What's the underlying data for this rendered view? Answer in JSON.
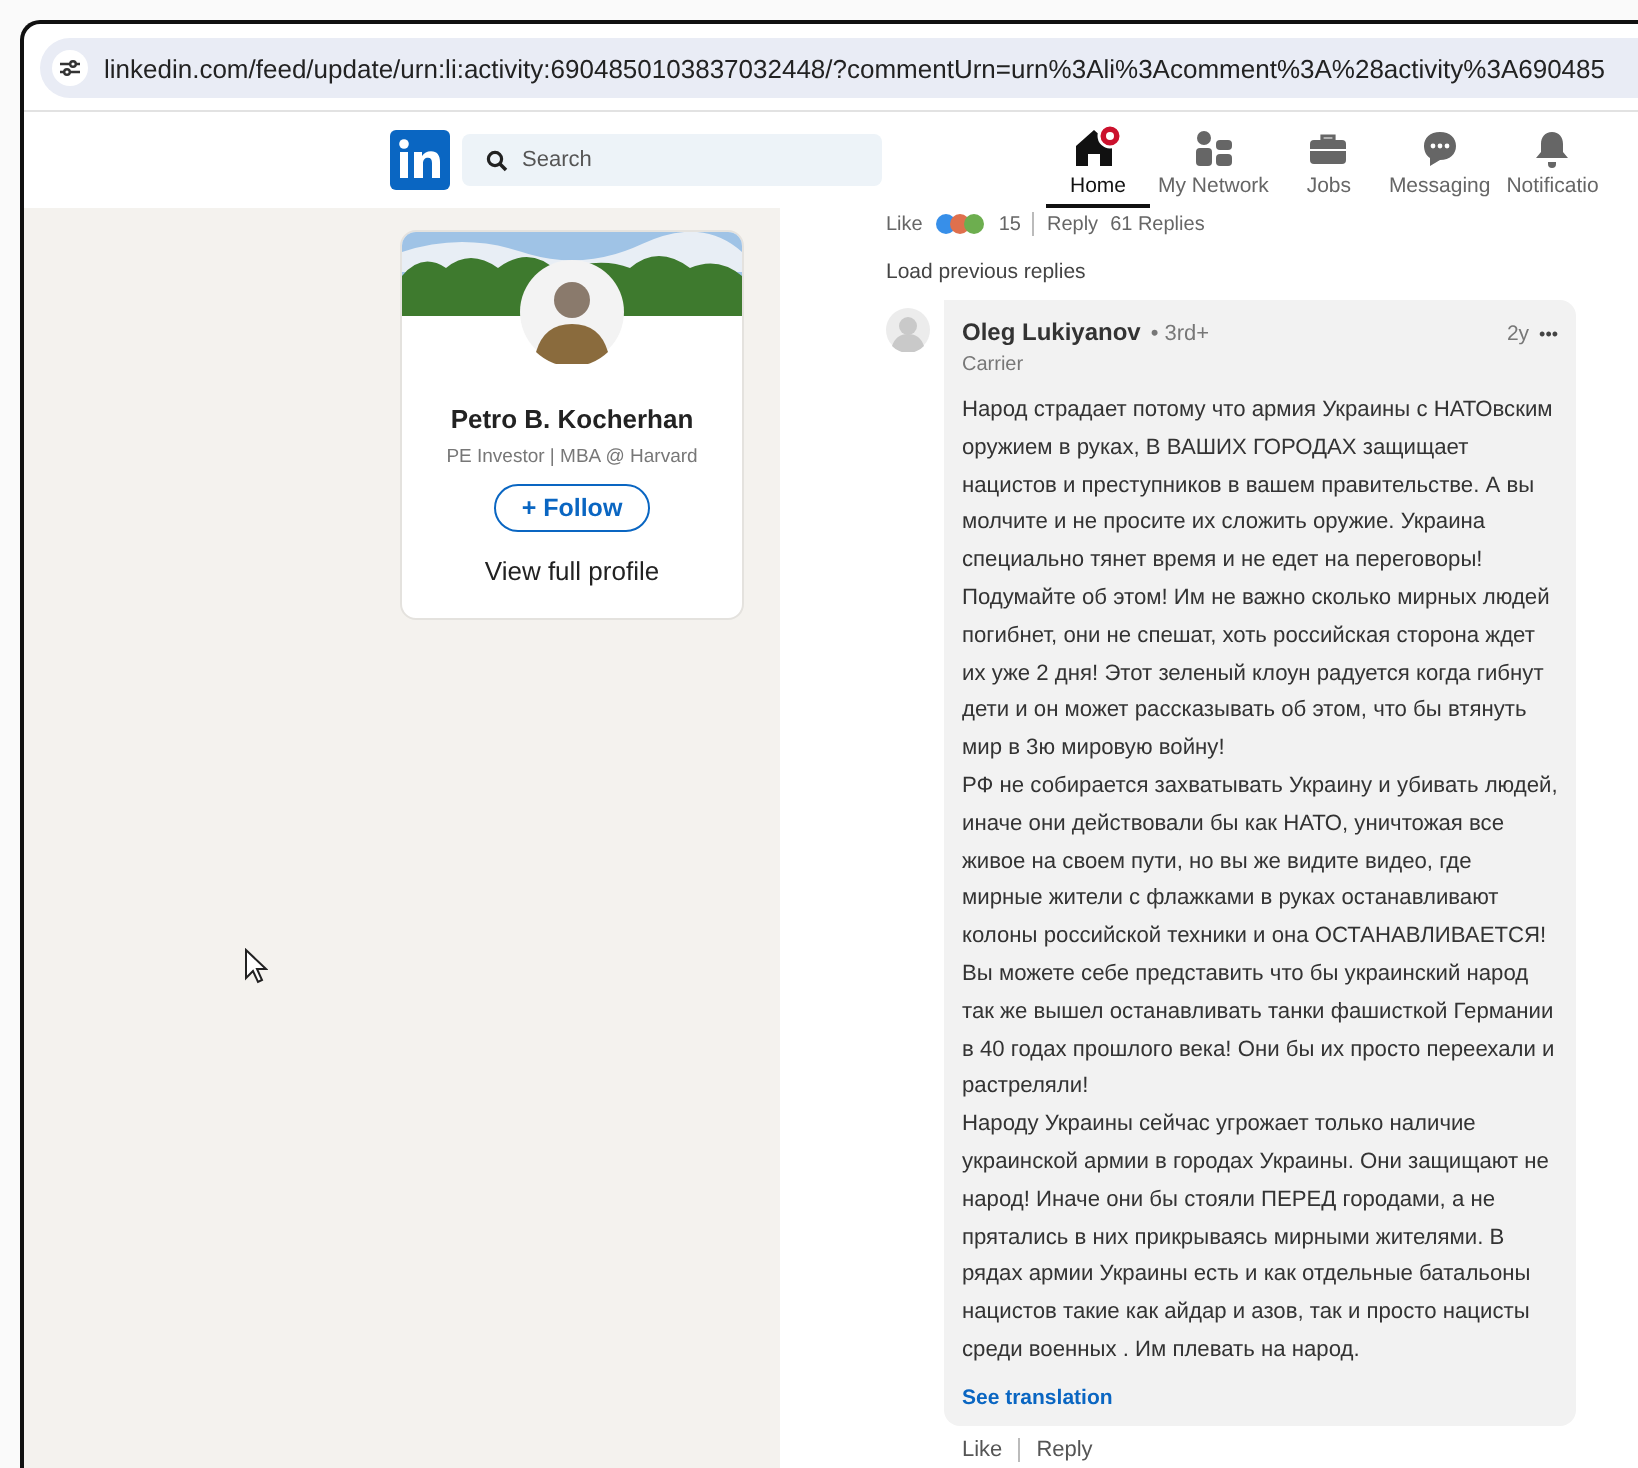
{
  "browser": {
    "url": "linkedin.com/feed/update/urn:li:activity:6904850103837032448/?commentUrn=urn%3Ali%3Acomment%3A%28activity%3A690485"
  },
  "nav": {
    "search": {
      "placeholder": "Search"
    },
    "items": [
      {
        "kind": "home",
        "label": "Home",
        "selected": true
      },
      {
        "kind": "network",
        "label": "My Network",
        "selected": false
      },
      {
        "kind": "jobs",
        "label": "Jobs",
        "selected": false
      },
      {
        "kind": "messaging",
        "label": "Messaging",
        "selected": false
      },
      {
        "kind": "bell",
        "label": "Notificatio",
        "selected": false
      }
    ]
  },
  "profile_card": {
    "name": "Petro B. Kocherhan",
    "headline": "PE Investor | MBA @ Harvard",
    "follow_button": "+ Follow",
    "view_profile": "View full profile"
  },
  "parent_actions": {
    "like": "Like",
    "reactions_count": "15",
    "reply": "Reply",
    "replies": "61 Replies"
  },
  "load_previous": "Load previous replies",
  "comment": {
    "author": "Oleg Lukiyanov",
    "degree": "• 3rd+",
    "age": "2y",
    "more": "•••",
    "subtitle": "Carrier",
    "paragraphs": [
      "Народ страдает потому что армия Украины с НАТОвским оружием в руках, В ВАШИХ ГОРОДАХ защищает нацистов и преступников в вашем правительстве. А вы молчите и не просите их сложить оружие. Украина специально тянет время и не едет на переговоры! Подумайте об этом! Им не важно сколько мирных людей погибнет, они не спешат, хоть российская сторона ждет их уже 2 дня! Этот зеленый клоун радуется когда гибнут дети и он может рассказывать об этом, что бы втянуть мир в 3ю мировую войну!",
      "РФ не собирается захватывать Украину и убивать людей, иначе они действовали бы как НАТО, уничтожая все живое на своем пути, но вы же видите видео, где мирные жители с флажками в руках останавливают колоны российской техники и она ОСТАНАВЛИВАЕТСЯ! Вы можете себе представить что бы украинский народ так же вышел останавливать танки фашисткой Германии в 40 годах прошлого века! Они бы их просто переехали и растреляли!",
      "Народу Украины сейчас угрожает только наличие украинской армии в городах Украины. Они защищают не народ! Иначе они бы стояли ПЕРЕД городами, а не прятались в них прикрываясь мирными жителями. В рядах армии Украины есть и как отдельные батальоны нацистов такие как айдар и азов, так и просто нацисты среди военных . Им плевать на народ."
    ],
    "see_translation": "See translation",
    "like": "Like",
    "reply": "Reply"
  }
}
